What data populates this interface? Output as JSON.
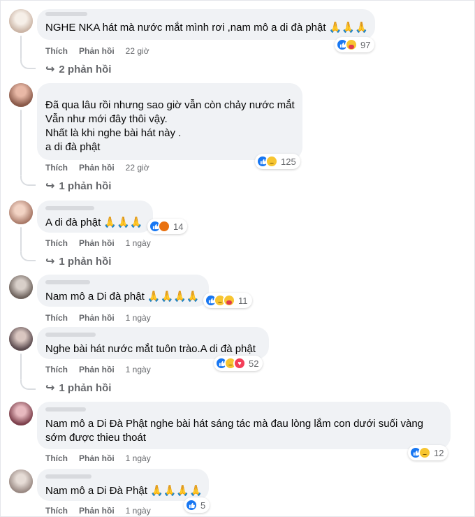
{
  "actions": {
    "like": "Thích",
    "reply": "Phản hồi"
  },
  "comments": [
    {
      "lines": [
        "NGHE NKA hát mà nước mắt mình rơi ,nam mô a di đà phật 🙏🙏🙏"
      ],
      "reactions": [
        "like",
        "care"
      ],
      "count": "97",
      "time": "22 giờ",
      "replies": "2 phản hồi"
    },
    {
      "lines": [
        "Đã qua lâu rồi nhưng sao giờ vẫn còn chảy nước mắt",
        "Vẫn như mới đây thôi vậy.",
        "Nhất là khi nghe bài hát này .",
        "a di đà phật"
      ],
      "reactions": [
        "like",
        "sad"
      ],
      "count": "125",
      "time": "22 giờ",
      "replies": "1 phản hồi"
    },
    {
      "lines": [
        "A di đà phật 🙏🙏🙏"
      ],
      "reactions": [
        "like",
        "angry"
      ],
      "count": "14",
      "time": "1 ngày",
      "replies": "1 phản hồi"
    },
    {
      "lines": [
        "Nam mô a Di đà phật 🙏🙏🙏🙏"
      ],
      "reactions": [
        "like",
        "sad",
        "care"
      ],
      "count": "11",
      "time": "1 ngày",
      "replies": ""
    },
    {
      "lines": [
        "Nghe bài hát nước mắt tuôn trào.A di đà phật"
      ],
      "reactions": [
        "like",
        "sad",
        "heart"
      ],
      "count": "52",
      "time": "1 ngày",
      "replies": "1 phản hồi"
    },
    {
      "lines": [
        "Nam mô a Di Đà Phật nghe bài hát sáng tác mà đau lòng lắm con dưới suối vàng",
        "sớm được thieu thoát"
      ],
      "reactions": [
        "like",
        "sad"
      ],
      "count": "12",
      "time": "1 ngày",
      "replies": ""
    },
    {
      "lines": [
        "Nam mô a Di Đà Phật 🙏🙏🙏🙏"
      ],
      "reactions": [
        "like"
      ],
      "count": "5",
      "time": "1 ngày",
      "replies": ""
    }
  ]
}
